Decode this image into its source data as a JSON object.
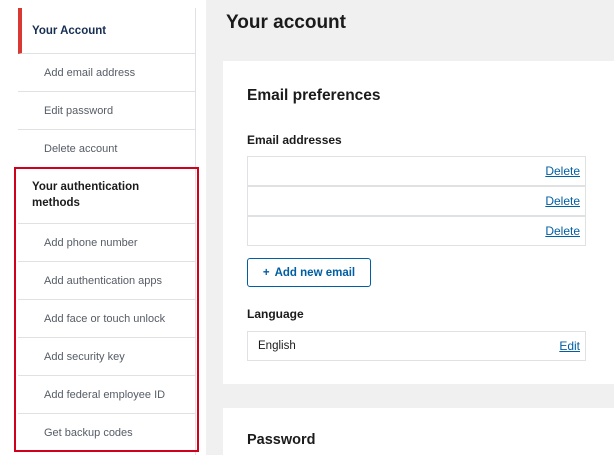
{
  "sidebar": {
    "items": [
      {
        "label": "Your Account"
      },
      {
        "label": "Add email address"
      },
      {
        "label": "Edit password"
      },
      {
        "label": "Delete account"
      },
      {
        "label": "Your authentication methods"
      },
      {
        "label": "Add phone number"
      },
      {
        "label": "Add authentication apps"
      },
      {
        "label": "Add face or touch unlock"
      },
      {
        "label": "Add security key"
      },
      {
        "label": "Add federal employee ID"
      },
      {
        "label": "Get backup codes"
      }
    ]
  },
  "main": {
    "title": "Your account",
    "email_card": {
      "title": "Email preferences",
      "addresses_label": "Email addresses",
      "rows": [
        {
          "address": "",
          "delete_label": "Delete"
        },
        {
          "address": "",
          "delete_label": "Delete"
        },
        {
          "address": "",
          "delete_label": "Delete"
        }
      ],
      "add_button_icon": "+",
      "add_button_label": "Add new email",
      "language_label": "Language",
      "language_value": "English",
      "edit_label": "Edit"
    },
    "password_card": {
      "title": "Password"
    }
  },
  "colors": {
    "accent": "#005ea2",
    "current_indicator": "#d83933",
    "highlight_box": "#d0021b",
    "background": "#f0f0f0"
  }
}
